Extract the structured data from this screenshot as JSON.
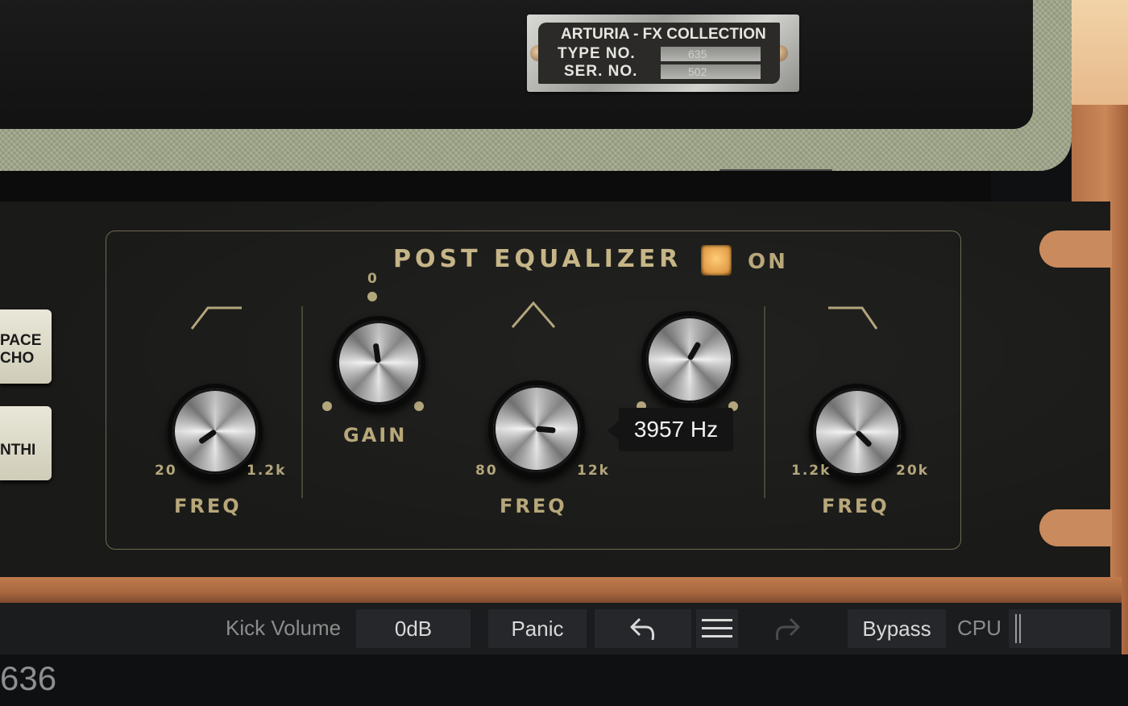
{
  "plate": {
    "title": "ARTURIA - FX COLLECTION",
    "type_label": "TYPE  NO.",
    "type_value": "635",
    "ser_label": "SER.  NO.",
    "ser_value": "502"
  },
  "side_buttons": [
    {
      "label_line1": "PACE",
      "label_line2": "CHO"
    },
    {
      "label_line1": "NTHI",
      "label_line2": ""
    }
  ],
  "post_eq": {
    "title": "POST EQUALIZER",
    "power_label": "ON",
    "low": {
      "min_label": "20",
      "max_label": "1.2k",
      "knob_label": "FREQ",
      "shape_icon": "low-shelf-icon"
    },
    "gain": {
      "center_label": "0",
      "knob_label": "GAIN"
    },
    "mid": {
      "min_label": "80",
      "max_label": "12k",
      "knob_label": "FREQ",
      "shape_icon": "peak-icon"
    },
    "high": {
      "min_label": "1.2k",
      "max_label": "20k",
      "knob_label": "FREQ",
      "shape_icon": "high-shelf-icon"
    },
    "tooltip": "3957 Hz"
  },
  "toolbar": {
    "kick_volume_label": "Kick Volume",
    "kick_volume_value": "0dB",
    "panic_label": "Panic",
    "undo_icon": "undo-icon",
    "menu_icon": "menu-icon",
    "redo_icon": "redo-icon",
    "bypass_label": "Bypass",
    "cpu_label": "CPU"
  },
  "status": {
    "text": "636"
  },
  "colors": {
    "accent": "#b7a77a",
    "led": "#f3b05a",
    "wood": "#b57148"
  }
}
